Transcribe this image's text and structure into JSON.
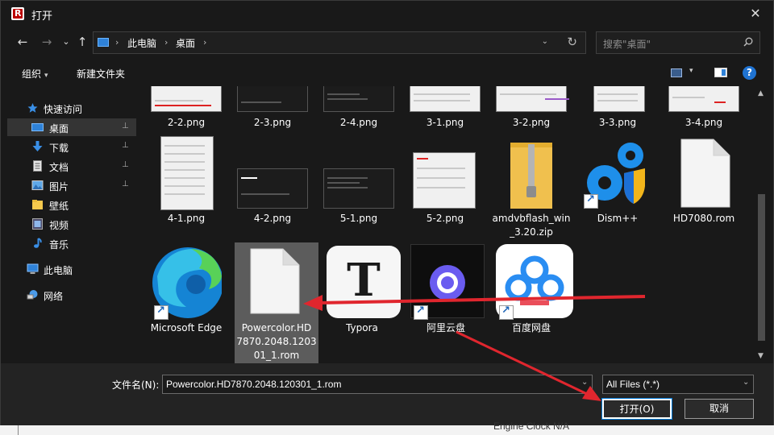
{
  "window": {
    "title": "打开",
    "close_glyph": "✕"
  },
  "nav": {
    "back_glyph": "←",
    "forward_glyph": "→",
    "recent_glyph": "⌄",
    "up_glyph": "↑",
    "breadcrumbs": [
      "此电脑",
      "桌面"
    ],
    "crumb_separator": "›",
    "dropdown_glyph": "⌄",
    "refresh_glyph": "↻",
    "search_placeholder": "搜索\"桌面\""
  },
  "toolbar": {
    "organize": "组织",
    "new_folder": "新建文件夹",
    "caret": "▾",
    "help": "?"
  },
  "sidebar": {
    "items": [
      {
        "label": "快速访问",
        "icon": "star-icon",
        "pinned": false,
        "active": false
      },
      {
        "label": "桌面",
        "icon": "desktop-icon",
        "pinned": true,
        "active": true
      },
      {
        "label": "下载",
        "icon": "download-icon",
        "pinned": true,
        "active": false
      },
      {
        "label": "文档",
        "icon": "document-icon",
        "pinned": true,
        "active": false
      },
      {
        "label": "图片",
        "icon": "picture-icon",
        "pinned": true,
        "active": false
      },
      {
        "label": "壁纸",
        "icon": "folder-icon",
        "pinned": false,
        "active": false
      },
      {
        "label": "视频",
        "icon": "video-icon",
        "pinned": false,
        "active": false
      },
      {
        "label": "音乐",
        "icon": "music-icon",
        "pinned": false,
        "active": false
      },
      {
        "label": "此电脑",
        "icon": "computer-icon",
        "pinned": false,
        "active": false
      },
      {
        "label": "网络",
        "icon": "network-icon",
        "pinned": false,
        "active": false
      }
    ],
    "pin_glyph": "📌"
  },
  "files": {
    "row1": [
      "2-2.png",
      "2-3.png",
      "2-4.png",
      "3-1.png",
      "3-2.png",
      "3-3.png",
      "3-4.png"
    ],
    "row2": [
      "4-1.png",
      "4-2.png",
      "5-1.png",
      "5-2.png",
      "amdvbflash_win_3.20.zip",
      "Dism++",
      "HD7080.rom"
    ],
    "row3": [
      "Microsoft Edge",
      "Powercolor.HD7870.2048.120301_1.rom",
      "Typora",
      "阿里云盘",
      "百度网盘"
    ],
    "row2_display": [
      "4-1.png",
      "4-2.png",
      "5-1.png",
      "5-2.png",
      "amdvbflash_win\n_3.20.zip",
      "Dism++",
      "HD7080.rom"
    ],
    "row3_display": [
      "Microsoft Edge",
      "Powercolor.HD\n7870.2048.1203\n01_1.rom",
      "Typora",
      "阿里云盘",
      "百度网盘"
    ],
    "selected": "Powercolor.HD7870.2048.120301_1.rom",
    "typora_letter": "T"
  },
  "scrollbar": {
    "up": "▲",
    "down": "▼"
  },
  "bottom": {
    "filename_label": "文件名(N):",
    "filename_value": "Powercolor.HD7870.2048.120301_1.rom",
    "filter_value": "All Files (*.*)",
    "dropdown_glyph": "⌄",
    "open_button": "打开(O)",
    "cancel_button": "取消"
  },
  "background_text": "Engine Clock     N/A",
  "colors": {
    "annotation_arrow": "#e0262e",
    "accent": "#0078d7",
    "dialog_bg": "#191919"
  }
}
